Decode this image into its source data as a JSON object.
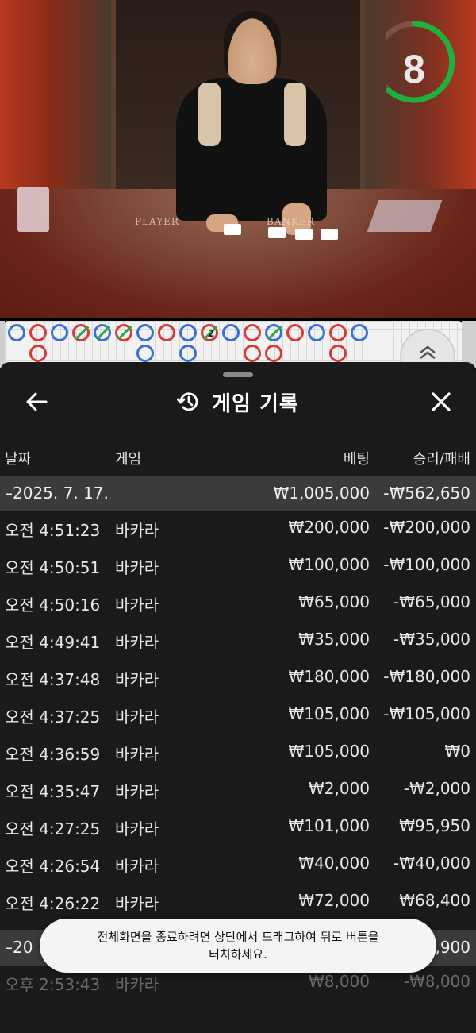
{
  "video": {
    "timer": "8",
    "table_label_player": "PLAYER",
    "table_label_banker": "BANKER",
    "roadmap_tie_count": "2",
    "expand_icon": "chevron-double-up-icon"
  },
  "header": {
    "title": "게임 기록",
    "back_icon": "arrow-left-icon",
    "history_icon": "history-clock-icon",
    "close_icon": "close-icon"
  },
  "columns": {
    "date": "날짜",
    "game": "게임",
    "bet": "베팅",
    "result": "승리/패배"
  },
  "group1": {
    "date": "–2025. 7. 17.",
    "bet": "₩1,005,000",
    "result": "-₩562,650"
  },
  "rows": [
    {
      "time": "오전 4:51:23",
      "game": "바카라",
      "bet": "₩200,000",
      "result": "-₩200,000"
    },
    {
      "time": "오전 4:50:51",
      "game": "바카라",
      "bet": "₩100,000",
      "result": "-₩100,000"
    },
    {
      "time": "오전 4:50:16",
      "game": "바카라",
      "bet": "₩65,000",
      "result": "-₩65,000"
    },
    {
      "time": "오전 4:49:41",
      "game": "바카라",
      "bet": "₩35,000",
      "result": "-₩35,000"
    },
    {
      "time": "오전 4:37:48",
      "game": "바카라",
      "bet": "₩180,000",
      "result": "-₩180,000"
    },
    {
      "time": "오전 4:37:25",
      "game": "바카라",
      "bet": "₩105,000",
      "result": "-₩105,000"
    },
    {
      "time": "오전 4:36:59",
      "game": "바카라",
      "bet": "₩105,000",
      "result": "₩0"
    },
    {
      "time": "오전 4:35:47",
      "game": "바카라",
      "bet": "₩2,000",
      "result": "-₩2,000"
    },
    {
      "time": "오전 4:27:25",
      "game": "바카라",
      "bet": "₩101,000",
      "result": "₩95,950"
    },
    {
      "time": "오전 4:26:54",
      "game": "바카라",
      "bet": "₩40,000",
      "result": "-₩40,000"
    },
    {
      "time": "오전 4:26:22",
      "game": "바카라",
      "bet": "₩72,000",
      "result": "₩68,400"
    }
  ],
  "group2": {
    "date": "–20",
    "result": ",900"
  },
  "last_row": {
    "time": "오후 2:53:43",
    "game": "바카라",
    "bet": "₩8,000",
    "result": "-₩8,000"
  },
  "toast": {
    "line1": "전체화면을 종료하려면 상단에서 드래그하여 뒤로 버튼을",
    "line2": "터치하세요."
  },
  "colors": {
    "player_blue": "#3a6fd8",
    "banker_red": "#d83a3a",
    "tie_green": "#2aa84a",
    "timer_green": "#1fb040",
    "sheet_bg": "#1a1a1a",
    "date_row_bg": "#3b3b3b"
  }
}
